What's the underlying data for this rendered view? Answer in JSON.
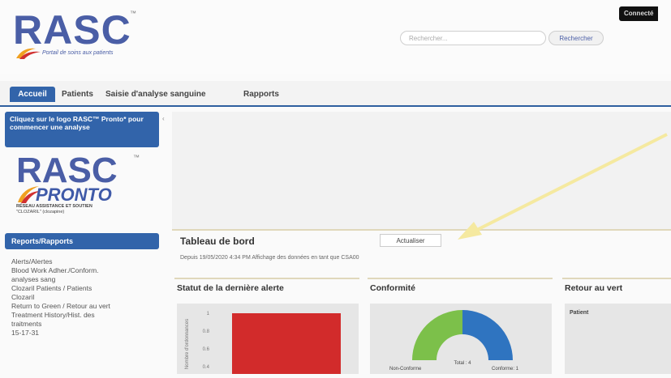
{
  "header": {
    "logo_text": "RASC",
    "logo_tm": "™",
    "tagline": "Portail de soins aux patients",
    "search_placeholder": "Rechercher...",
    "search_button": "Rechercher",
    "connected": "Connecté"
  },
  "nav": {
    "tabs": [
      {
        "label": "Accueil",
        "active": true
      },
      {
        "label": "Patients"
      },
      {
        "label": "Saisie d'analyse sanguine"
      },
      {
        "label": "Rapports"
      }
    ]
  },
  "sidebar": {
    "hint": "Cliquez sur le logo RASC™ Pronto* pour commencer une analyse",
    "pronto_logo": {
      "rasc": "RASC",
      "tm": "™",
      "pronto": "PRONTO",
      "sub1": "RÉSEAU ASSISTANCE ET SOUTIEN",
      "sub2": "\"CLOZARIL\" (clozapine)"
    },
    "reports_header": "Reports/Rapports",
    "links": [
      "Alerts/Alertes",
      "Blood Work Adher./Conform.",
      "analyses sang",
      "Clozaril Patients / Patients",
      "Clozaril",
      "Return to Green / Retour au vert",
      "Treatment History/Hist. des",
      "traitments",
      "15-17-31"
    ],
    "collapse_glyph": "‹"
  },
  "main": {
    "dashboard_title": "Tableau de bord",
    "refresh_button": "Actualiser",
    "since_text": "Depuis 19/05/2020 4:34 PM  Affichage des données en tant que CSA00",
    "cards": [
      {
        "title": "Statut de la dernière alerte"
      },
      {
        "title": "Conformité"
      },
      {
        "title": "Retour au vert",
        "column": "Patient"
      }
    ],
    "bar_chart": {
      "y_ticks": [
        "1",
        "0.8",
        "0.6",
        "0.4"
      ],
      "y_label": "Nombre d'ordonnances",
      "bar_color": "#d22b2b"
    },
    "donut": {
      "center_label": "Total : 4",
      "left_label": "Non-Conforme",
      "right_label": "Conforme: 1",
      "colors": {
        "green": "#7cc04a",
        "blue": "#2f74c0"
      }
    }
  },
  "colors": {
    "brand_blue": "#3264aa",
    "arrow": "#f5e9a0"
  }
}
